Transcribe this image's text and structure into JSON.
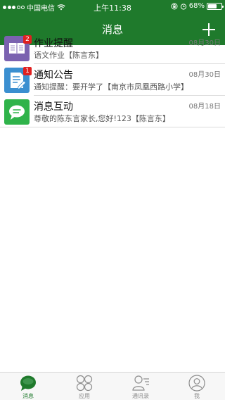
{
  "status_bar": {
    "carrier": "中国电信",
    "time": "上午11:38",
    "battery_text": "68%",
    "battery_level": 0.68
  },
  "nav": {
    "title": "消息",
    "add_icon": "plus-icon"
  },
  "messages": [
    {
      "icon": "book-icon",
      "icon_color": "#7b62b0",
      "badge": "2",
      "title": "作业提醒",
      "date": "08月30日",
      "preview": "语文作业【陈言东】"
    },
    {
      "icon": "notice-icon",
      "icon_color": "#3b8fd0",
      "badge": "1",
      "title": "通知公告",
      "date": "08月30日",
      "preview": "通知提醒：要开学了【南京市凤凰西路小学】"
    },
    {
      "icon": "chat-icon",
      "icon_color": "#2fb34a",
      "badge": "",
      "title": "消息互动",
      "date": "08月18日",
      "preview": "尊敬的陈东言家长,您好!123【陈言东】"
    }
  ],
  "tabs": [
    {
      "label": "消息",
      "icon": "chat-bubble-icon",
      "active": true
    },
    {
      "label": "应用",
      "icon": "apps-grid-icon",
      "active": false
    },
    {
      "label": "通讯录",
      "icon": "contacts-icon",
      "active": false
    },
    {
      "label": "我",
      "icon": "profile-icon",
      "active": false
    }
  ],
  "colors": {
    "brand_green": "#1f7a2c",
    "badge_red": "#e02020"
  }
}
